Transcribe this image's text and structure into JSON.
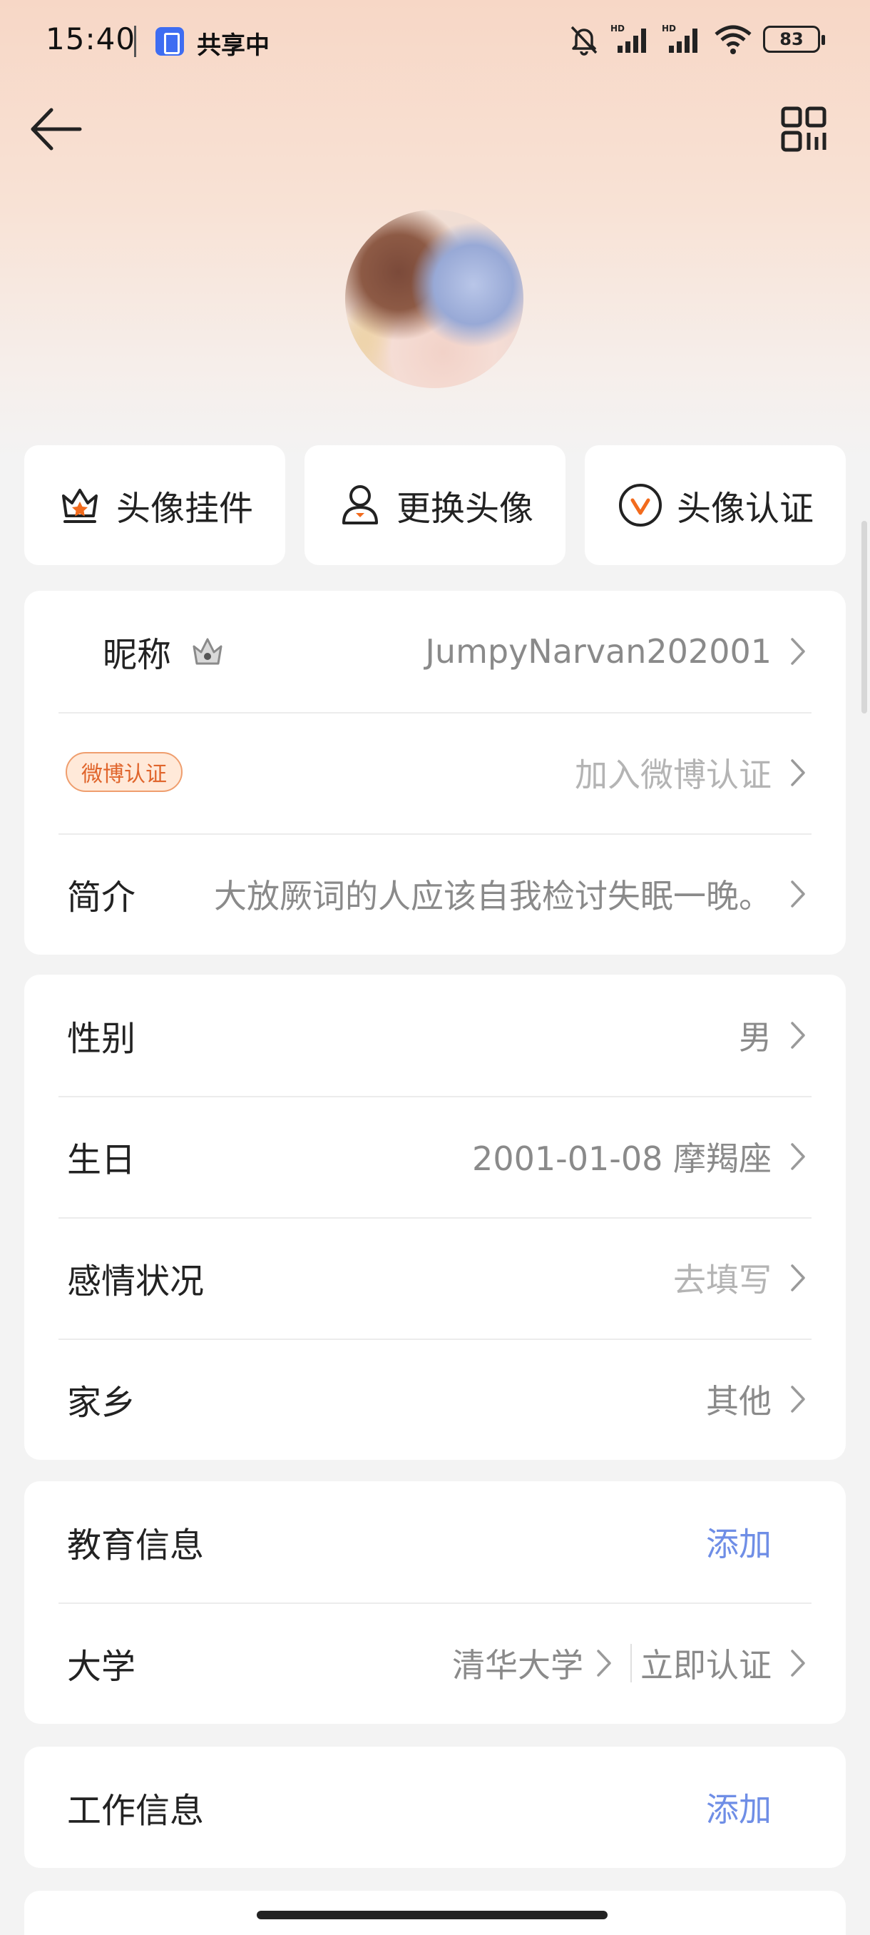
{
  "status_bar": {
    "time": "15:40",
    "share_label": "共享中",
    "battery": "83",
    "icons": [
      "mute-bell-icon",
      "hd-signal-icon",
      "hd-signal-icon",
      "wifi-icon",
      "battery-icon"
    ]
  },
  "nav": {
    "back_icon": "back-arrow-icon",
    "qr_icon": "qr-code-icon"
  },
  "actions": [
    {
      "label": "头像挂件",
      "icon": "crown-frame-icon"
    },
    {
      "label": "更换头像",
      "icon": "person-icon"
    },
    {
      "label": "头像认证",
      "icon": "verified-v-icon"
    }
  ],
  "profile": {
    "nickname_label": "昵称",
    "nickname_value": "JumpyNarvan202001",
    "weibo_badge": "微博认证",
    "weibo_value": "加入微博认证",
    "bio_label": "简介",
    "bio_value": "大放厥词的人应该自我检讨失眠一晚。"
  },
  "basic": {
    "gender_label": "性别",
    "gender_value": "男",
    "birthday_label": "生日",
    "birthday_value": "2001-01-08 摩羯座",
    "relationship_label": "感情状况",
    "relationship_value": "去填写",
    "hometown_label": "家乡",
    "hometown_value": "其他"
  },
  "education": {
    "title": "教育信息",
    "add_label": "添加",
    "university_label": "大学",
    "university_value": "清华大学",
    "verify_label": "立即认证"
  },
  "work": {
    "title": "工作信息",
    "add_label": "添加"
  },
  "colors": {
    "accent_link": "#6f8ee6",
    "badge_orange": "#e0652c",
    "avatar_verify": "#f26b1d"
  }
}
